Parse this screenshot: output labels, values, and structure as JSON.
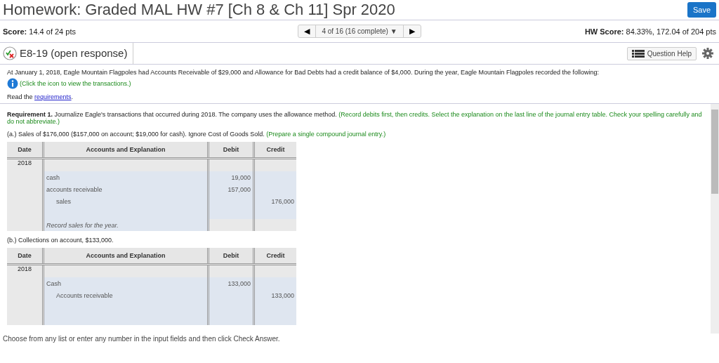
{
  "title": "Homework: Graded MAL HW #7 [Ch 8 & Ch 11] Spr 2020",
  "save_button": "Save",
  "score": {
    "label": "Score:",
    "value": "14.4 of 24 pts"
  },
  "navigator": {
    "prev": "◀",
    "position": "4 of 16 (16 complete)",
    "dropdown": "▼",
    "next": "▶"
  },
  "hw_score": {
    "label": "HW Score:",
    "value": "84.33%, 172.04 of 204 pts"
  },
  "question": {
    "title": "E8-19 (open response)",
    "help_button": "Question Help"
  },
  "intro": "At January 1, 2018, Eagle Mountain Flagpoles had Accounts Receivable of $29,000 and Allowance for Bad Debts had a credit balance of $4,000. During the year, Eagle Mountain Flagpoles recorded the following:",
  "info_hint": "(Click the icon to view the transactions.)",
  "read_prefix": "Read the",
  "read_link": "requirements",
  "read_suffix": ".",
  "requirement": {
    "label": "Requirement 1.",
    "text": "Journalize Eagle's transactions that occurred during 2018. The company uses the allowance method.",
    "hint": "(Record debits first, then credits. Select the explanation on the last line of the journal entry table. Check your spelling carefully and do not abbreviate.)"
  },
  "parts": [
    {
      "text": "(a.) Sales of $176,000 ($157,000 on account; $19,000 for cash). Ignore Cost of Goods Sold.",
      "hint": "(Prepare a single compound journal entry.)",
      "columns": [
        "Date",
        "Accounts and Explanation",
        "Debit",
        "Credit"
      ],
      "rows": [
        {
          "kind": "date",
          "date": "2018"
        },
        {
          "kind": "debit",
          "account": "cash",
          "debit": "19,000"
        },
        {
          "kind": "debit",
          "account": "accounts receivable",
          "debit": "157,000"
        },
        {
          "kind": "credit",
          "account": "sales",
          "credit": "176,000"
        },
        {
          "kind": "blank"
        },
        {
          "kind": "explanation",
          "account": "Record sales for the year."
        }
      ]
    },
    {
      "text": "(b.) Collections on account, $133,000.",
      "columns": [
        "Date",
        "Accounts and Explanation",
        "Debit",
        "Credit"
      ],
      "rows": [
        {
          "kind": "date",
          "date": "2018"
        },
        {
          "kind": "debit",
          "account": "Cash",
          "debit": "133,000"
        },
        {
          "kind": "credit",
          "account": "Accounts receivable",
          "credit": "133,000"
        },
        {
          "kind": "blank"
        },
        {
          "kind": "blank"
        }
      ]
    }
  ],
  "footer": "Choose from any list or enter any number in the input fields and then click Check Answer."
}
